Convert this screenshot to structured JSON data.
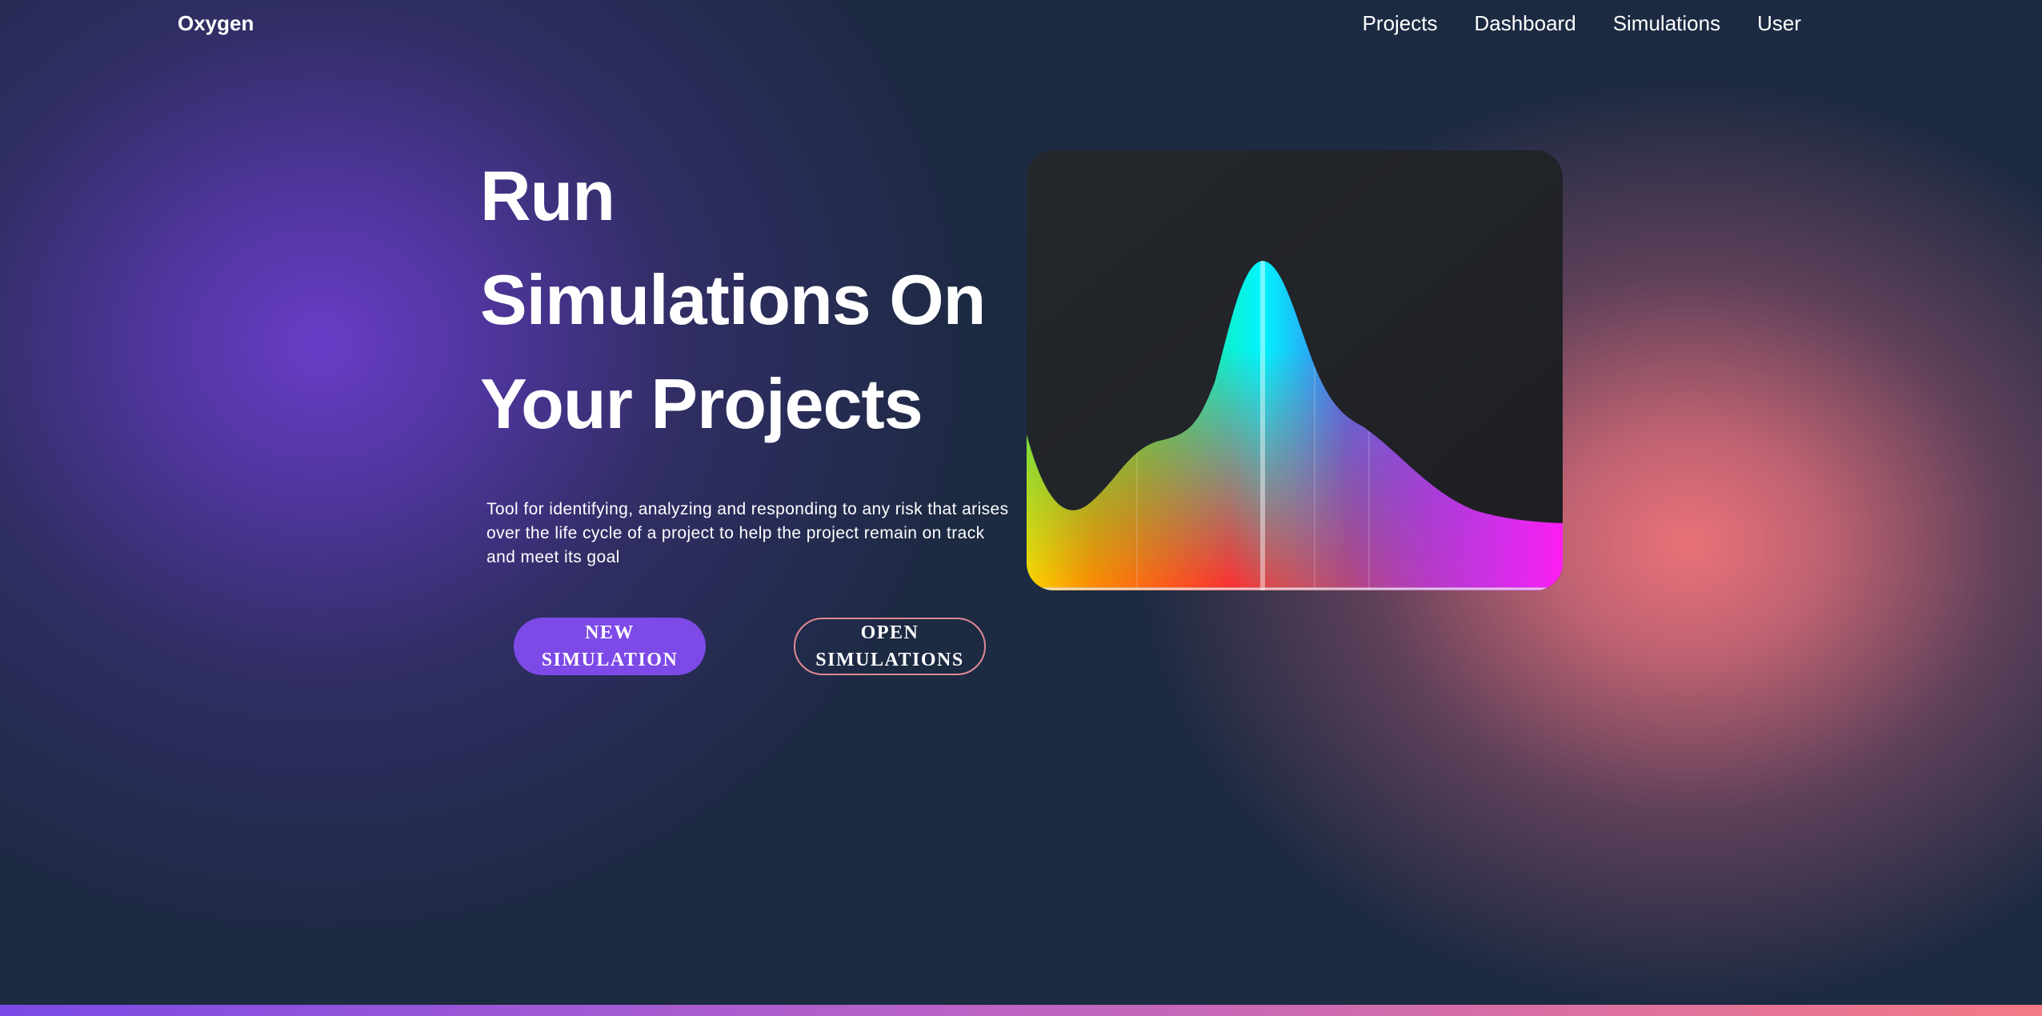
{
  "nav": {
    "brand": "Oxygen",
    "links": [
      "Projects",
      "Dashboard",
      "Simulations",
      "User"
    ]
  },
  "hero": {
    "title_lines": [
      "Run",
      "Simulations On",
      "Your Projects"
    ],
    "description": "Tool for identifying, analyzing and responding to any risk that arises over the life cycle of a project to help the project remain on track and meet its goal",
    "buttons": {
      "new_simulation": "NEW SIMULATION",
      "open_simulations": "OPEN SIMULATIONS"
    }
  },
  "illustration": {
    "name": "simulation-curve-illustration",
    "curve_colors": [
      "#ffd400",
      "#ff8a00",
      "#ff2e2e",
      "#34e05a",
      "#00f5ff",
      "#4a6cf0",
      "#8f45f0",
      "#ff1ef0"
    ]
  },
  "colors": {
    "background": "#1c2a42",
    "accent_purple": "#7d4ae7",
    "accent_pink": "#f07a80",
    "outline_border": "#e08a94"
  }
}
